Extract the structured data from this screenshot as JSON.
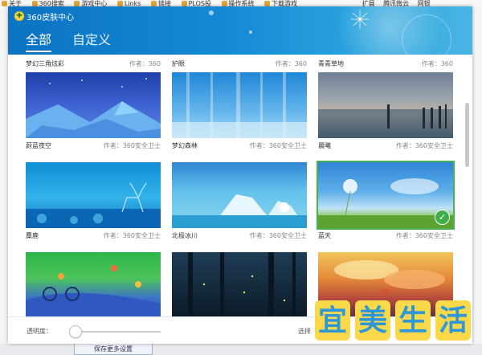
{
  "browser": {
    "bookmarks": [
      "关于",
      "360搜索",
      "游戏中心",
      "Links",
      "链接",
      "PLOS投",
      "操作系统",
      "下载游戏"
    ],
    "right_items": [
      "扩展",
      "腾讯微云",
      "网银"
    ],
    "bottom_button": "保存更多设置"
  },
  "app": {
    "title": "360皮肤中心",
    "tabs": [
      "全部",
      "自定义"
    ]
  },
  "skins": [
    {
      "name": "梦幻三角炫彩",
      "author": "作者：360"
    },
    {
      "name": "护眼",
      "author": "作者：360"
    },
    {
      "name": "青青草地",
      "author": "作者：360"
    },
    {
      "name": "蔚蓝夜空",
      "author": "作者：360安全卫士"
    },
    {
      "name": "梦幻森林",
      "author": "作者：360安全卫士"
    },
    {
      "name": "晨曦",
      "author": "作者：360安全卫士"
    },
    {
      "name": "麋鹿",
      "author": "作者：360安全卫士"
    },
    {
      "name": "北极冰川",
      "author": "作者：360安全卫士"
    },
    {
      "name": "蓝天",
      "author": "作者：360安全卫士"
    }
  ],
  "footer": {
    "opacity_label": "透明度：",
    "opacity_value": 0.05,
    "select_text": "选择"
  },
  "watermark": [
    "宜",
    "美",
    "生",
    "活"
  ],
  "colors": {
    "header": "#1488d4",
    "selected": "#4caf50",
    "watermark_bg": "#f9d949",
    "watermark_text": "#2f97d6"
  }
}
